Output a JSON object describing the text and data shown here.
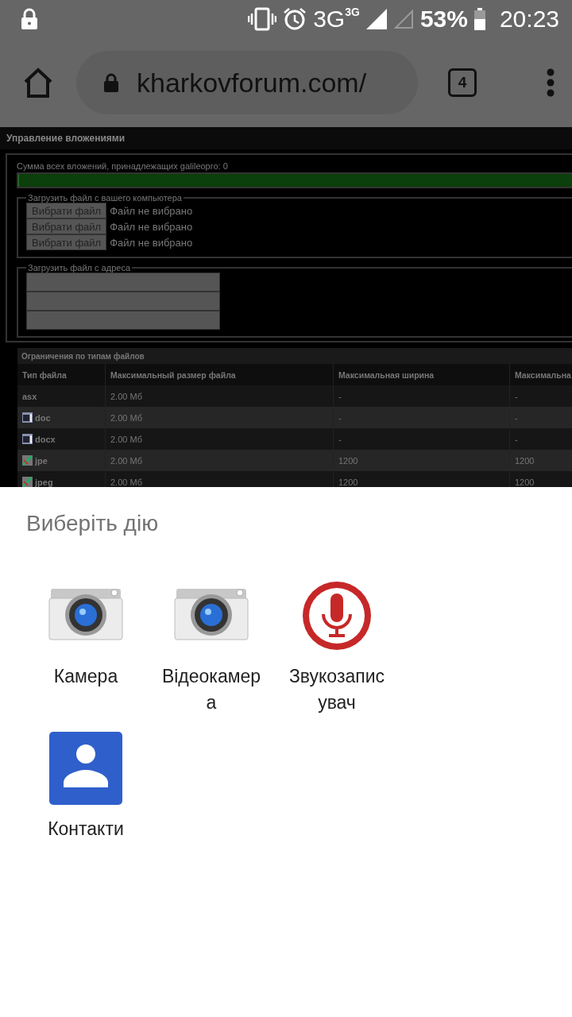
{
  "status_bar": {
    "network": "3G",
    "network_small": "3G",
    "battery": "53%",
    "time": "20:23"
  },
  "browser": {
    "url": "kharkovforum.com/",
    "tab_count": "4"
  },
  "page": {
    "title": "Управление вложениями",
    "usage_label": "Сумма всех вложений, принадлежащих galileopro: 0",
    "upload_local": {
      "legend": "Загрузить файл с вашего компьютера",
      "rows": [
        {
          "button": "Вибрати файл",
          "status": "Файл не вибрано"
        },
        {
          "button": "Вибрати файл",
          "status": "Файл не вибрано"
        },
        {
          "button": "Вибрати файл",
          "status": "Файл не вибрано"
        }
      ]
    },
    "upload_url": {
      "legend": "Загрузить файл с адреса"
    },
    "table": {
      "title": "Ограничения по типам файлов",
      "columns": [
        "Тип файла",
        "Максимальный размер файла",
        "Максимальная ширина",
        "Максимальна"
      ],
      "rows": [
        {
          "kind": "plain",
          "cells": [
            "asx",
            "2.00 Мб",
            "-",
            "-"
          ]
        },
        {
          "kind": "document",
          "cells": [
            "doc",
            "2.00 Мб",
            "-",
            "-"
          ]
        },
        {
          "kind": "document",
          "cells": [
            "docx",
            "2.00 Мб",
            "-",
            "-"
          ]
        },
        {
          "kind": "image",
          "cells": [
            "jpe",
            "2.00 Мб",
            "1200",
            "1200"
          ]
        },
        {
          "kind": "image",
          "cells": [
            "jpeg",
            "2.00 Мб",
            "1200",
            "1200"
          ]
        }
      ]
    }
  },
  "sheet": {
    "title": "Виберіть дію",
    "apps": [
      {
        "kind": "camera",
        "label": "Камера"
      },
      {
        "kind": "camera",
        "label": "Відеокамера"
      },
      {
        "kind": "recorder",
        "label": "Звукозаписувач"
      },
      {
        "kind": "contacts",
        "label": "Контакти"
      }
    ]
  }
}
